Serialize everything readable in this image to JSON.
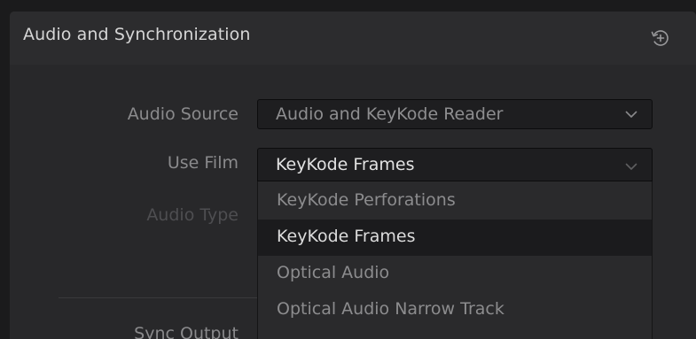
{
  "panel": {
    "title": "Audio and Synchronization",
    "reset_icon": "reset-history-icon"
  },
  "fields": {
    "audio_source": {
      "label": "Audio Source",
      "value": "Audio and KeyKode Reader"
    },
    "use_film": {
      "label": "Use Film",
      "value": "KeyKode Frames"
    },
    "audio_type": {
      "label": "Audio Type"
    },
    "sync_output": {
      "label": "Sync Output"
    }
  },
  "dropdown": {
    "options": [
      "KeyKode Perforations",
      "KeyKode Frames",
      "Optical Audio",
      "Optical Audio Narrow Track"
    ],
    "selected_index": 1
  },
  "colors": {
    "text_primary": "#d6d6d6",
    "text_secondary": "#8a8a8c",
    "text_disabled": "#4e4e51",
    "select_bg": "#1e1e20",
    "panel_bg": "#28282a"
  }
}
